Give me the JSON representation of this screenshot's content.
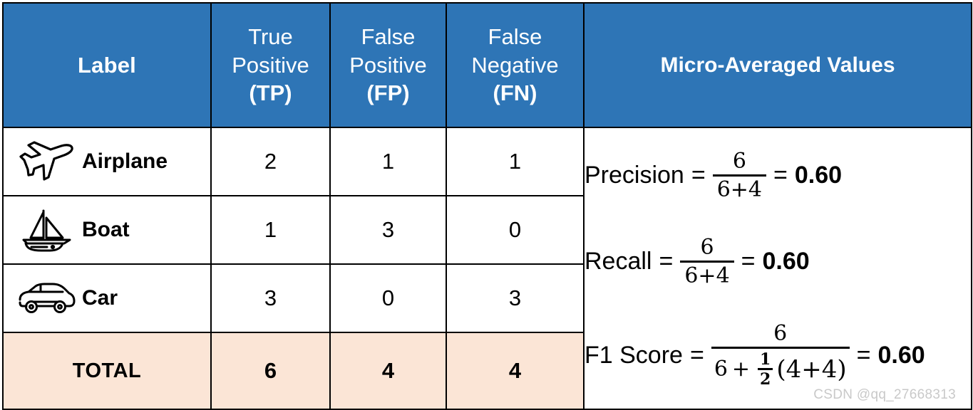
{
  "table": {
    "headers": [
      {
        "id": "label",
        "label": "Label",
        "lines": [
          "Label"
        ],
        "abbr": ""
      },
      {
        "id": "tp",
        "label": "True Positive (TP)",
        "lines": [
          "True",
          "Positive"
        ],
        "abbr": "(TP)"
      },
      {
        "id": "fp",
        "label": "False Positive (FP)",
        "lines": [
          "False",
          "Positive"
        ],
        "abbr": "(FP)"
      },
      {
        "id": "fn",
        "label": "False Negative (FN)",
        "lines": [
          "False",
          "Negative"
        ],
        "abbr": "(FN)"
      },
      {
        "id": "micro",
        "label": "Micro-Averaged Values",
        "lines": [
          "Micro-Averaged Values"
        ],
        "abbr": ""
      }
    ],
    "rows": [
      {
        "icon": "airplane-icon",
        "label": "Airplane",
        "tp": "2",
        "fp": "1",
        "fn": "1"
      },
      {
        "icon": "boat-icon",
        "label": "Boat",
        "tp": "1",
        "fp": "3",
        "fn": "0"
      },
      {
        "icon": "car-icon",
        "label": "Car",
        "tp": "3",
        "fp": "0",
        "fn": "3"
      }
    ],
    "total_row": {
      "label": "TOTAL",
      "tp": "6",
      "fp": "4",
      "fn": "4"
    }
  },
  "formulas": [
    {
      "id": "precision",
      "name": "Precision",
      "equals": "=",
      "numerator": "6",
      "denominator": "6+4",
      "result_equals": "=",
      "result": "0.60"
    },
    {
      "id": "recall",
      "name": "Recall",
      "equals": "=",
      "numerator": "6",
      "denominator": "6+4",
      "result_equals": "=",
      "result": "0.60"
    },
    {
      "id": "f1-score",
      "name": "F1 Score",
      "equals": "=",
      "numerator": "6",
      "denominator_parts": {
        "lead": "6",
        "plus": "+",
        "half_num": "1",
        "half_den": "2",
        "group": "(4+4)"
      },
      "result_equals": "=",
      "result": "0.60"
    }
  ],
  "watermark": "CSDN @qq_27668313",
  "colors": {
    "header_blue": "#2E75B6",
    "total_peach": "#FBE5D6",
    "border": "#000000",
    "text": "#000000",
    "header_text": "#FFFFFF",
    "watermark_text": "#C9C9C9"
  }
}
